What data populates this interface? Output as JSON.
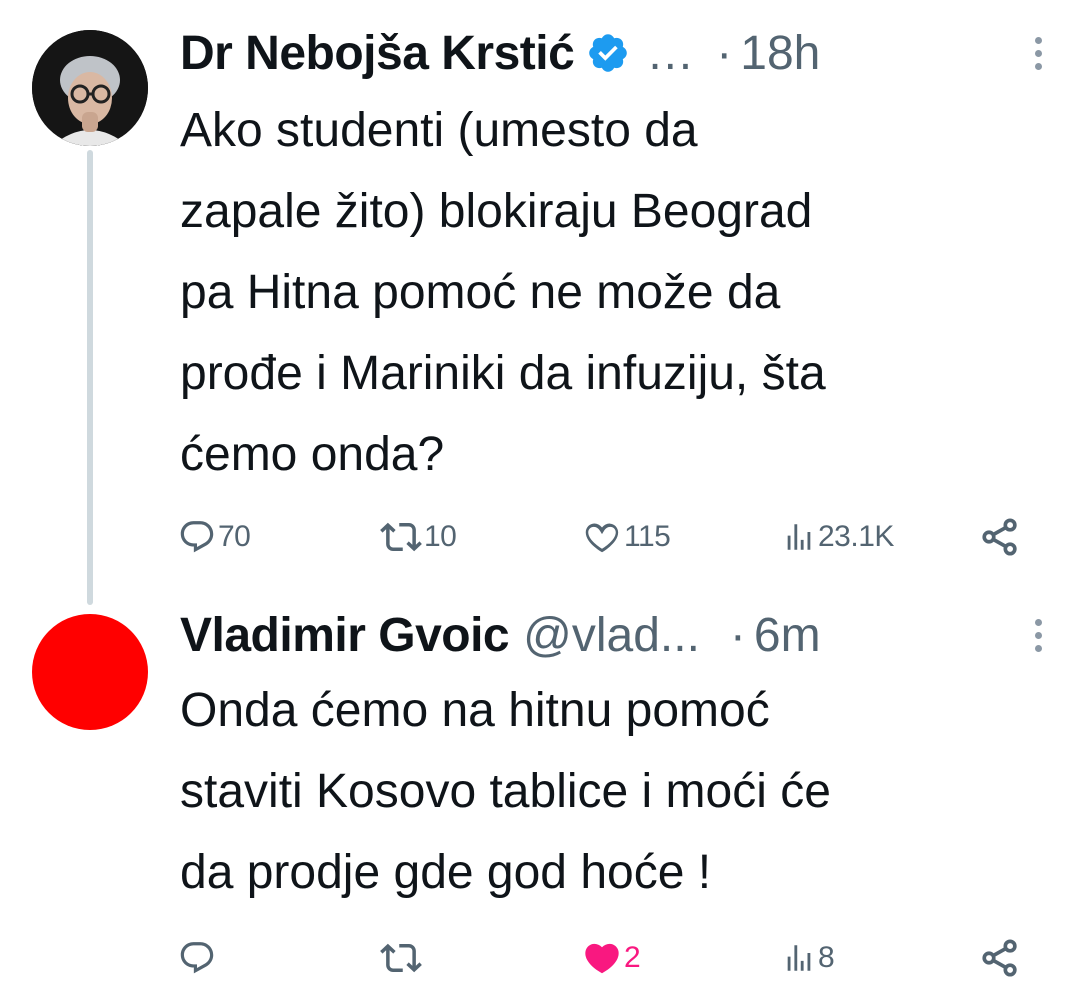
{
  "tweets": [
    {
      "author_name": "Dr Nebojša Krstić",
      "handle": "…",
      "separator": "·",
      "time": "18h",
      "verified": true,
      "text": "Ako studenti (umesto da\nzapale žito) blokiraju Beograd\npa Hitna pomoć ne može da\nprođe i Mariniki da infuziju, šta\nćemo onda?",
      "replies": "70",
      "reposts": "10",
      "likes": "115",
      "views": "23.1K",
      "liked": false
    },
    {
      "author_name": "Vladimir Gvoic",
      "handle": "@vlad...",
      "separator": "·",
      "time": "6m",
      "verified": false,
      "text": "Onda ćemo na hitnu pomoć\nstaviti Kosovo tablice i moći će\nda prodje gde god hoće !",
      "replies": "",
      "reposts": "",
      "likes": "2",
      "views": "8",
      "liked": true
    }
  ],
  "colors": {
    "text": "#0f1419",
    "secondary": "#536471",
    "verified_blue": "#1d9bf0",
    "like_pink": "#f91880",
    "thread_line": "#cfd9de",
    "avatar_red": "#ff0000"
  },
  "icons": {
    "reply": "reply-icon",
    "repost": "repost-icon",
    "like": "heart-icon",
    "views": "views-icon",
    "share": "share-icon",
    "verified": "verified-badge-icon",
    "more": "more-options-icon"
  }
}
